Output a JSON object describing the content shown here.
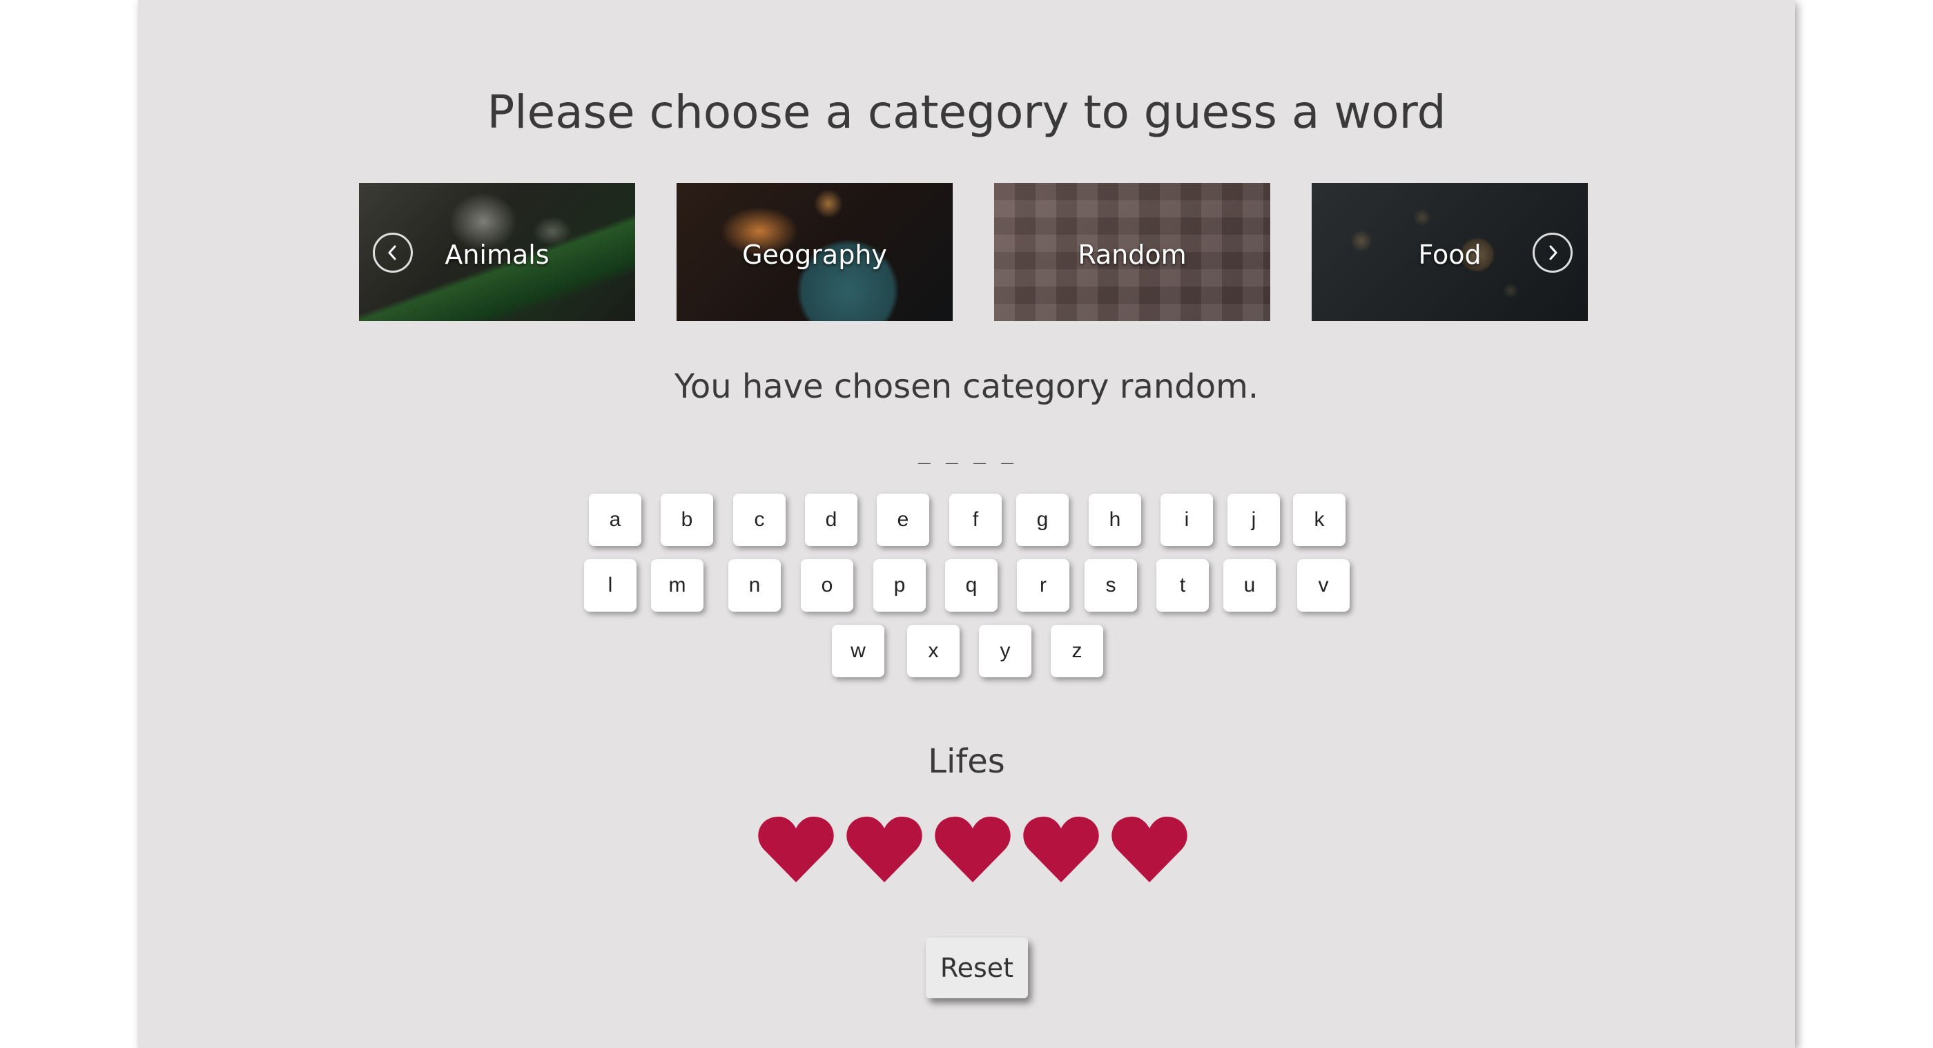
{
  "header": {
    "title": "Please choose a category to guess a word"
  },
  "categories": [
    {
      "label": "Animals"
    },
    {
      "label": "Geography"
    },
    {
      "label": "Random"
    },
    {
      "label": "Food"
    }
  ],
  "carousel": {
    "prev_icon": "chevron-left-circle-icon",
    "next_icon": "chevron-right-circle-icon"
  },
  "status": {
    "chosen_text": "You have chosen category random.",
    "word_blanks": "_ _ _ _"
  },
  "keyboard": {
    "row1": [
      "a",
      "b",
      "c",
      "d",
      "e",
      "f",
      "g",
      "h",
      "i",
      "j",
      "k"
    ],
    "row2": [
      "l",
      "m",
      "n",
      "o",
      "p",
      "q",
      "r",
      "s",
      "t",
      "u",
      "v"
    ],
    "row3": [
      "w",
      "x",
      "y",
      "z"
    ]
  },
  "lifes": {
    "title": "Lifes",
    "count": 5,
    "icon": "heart-icon",
    "color": "#b5123f"
  },
  "reset": {
    "label": "Reset"
  },
  "colors": {
    "panel_bg": "#e4e2e3",
    "text": "#3a3a3a",
    "heart": "#b5123f"
  }
}
